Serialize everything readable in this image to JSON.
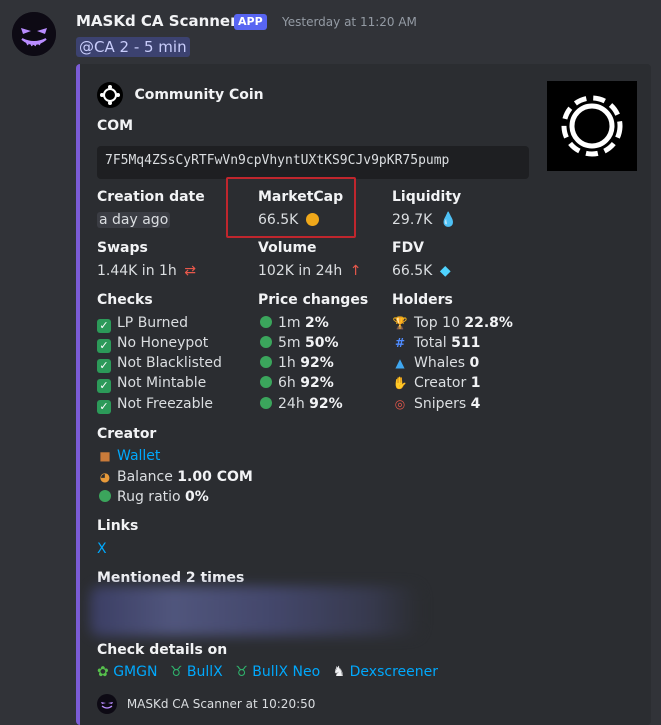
{
  "message": {
    "username": "MASKd CA Scanner",
    "badge": "APP",
    "timestamp": "Yesterday at 11:20 AM",
    "mention": "@CA 2 - 5 min"
  },
  "embed": {
    "author": "Community Coin",
    "ticker": "COM",
    "contract": "7F5Mq4ZSsCyRTFwVn9cpVhyntUXtKS9CJv9pKR75pump",
    "accent_color": "#7b5cd6",
    "creation_date": {
      "label": "Creation date",
      "value": "a day ago"
    },
    "marketcap": {
      "label": "MarketCap",
      "value": "66.5K"
    },
    "liquidity": {
      "label": "Liquidity",
      "value": "29.7K"
    },
    "swaps": {
      "label": "Swaps",
      "value": "1.44K in 1h"
    },
    "volume": {
      "label": "Volume",
      "value": "102K in 24h"
    },
    "fdv": {
      "label": "FDV",
      "value": "66.5K"
    },
    "checks": {
      "label": "Checks",
      "items": [
        "LP Burned",
        "No Honeypot",
        "Not Blacklisted",
        "Not Mintable",
        "Not Freezable"
      ]
    },
    "price_changes": {
      "label": "Price changes",
      "items": [
        {
          "period": "1m",
          "value": "2%"
        },
        {
          "period": "5m",
          "value": "50%"
        },
        {
          "period": "1h",
          "value": "92%"
        },
        {
          "period": "6h",
          "value": "92%"
        },
        {
          "period": "24h",
          "value": "92%"
        }
      ]
    },
    "holders": {
      "label": "Holders",
      "items": [
        {
          "name": "Top 10",
          "value": "22.8%",
          "icon": "trophy-icon"
        },
        {
          "name": "Total",
          "value": "511",
          "icon": "numbers-icon"
        },
        {
          "name": "Whales",
          "value": "0",
          "icon": "whale-icon"
        },
        {
          "name": "Creator",
          "value": "1",
          "icon": "creator-icon"
        },
        {
          "name": "Snipers",
          "value": "4",
          "icon": "target-icon"
        }
      ]
    },
    "creator": {
      "label": "Creator",
      "wallet": "Wallet",
      "balance_label": "Balance",
      "balance_value": "1.00 COM",
      "rug_label": "Rug ratio",
      "rug_value": "0%"
    },
    "links": {
      "label": "Links",
      "x": "X"
    },
    "mentioned": {
      "label": "Mentioned 2 times"
    },
    "check_details": {
      "label": "Check details on",
      "items": [
        "GMGN",
        "BullX",
        "BullX Neo",
        "Dexscreener"
      ]
    },
    "footer": "MASKd CA Scanner at 10:20:50"
  }
}
